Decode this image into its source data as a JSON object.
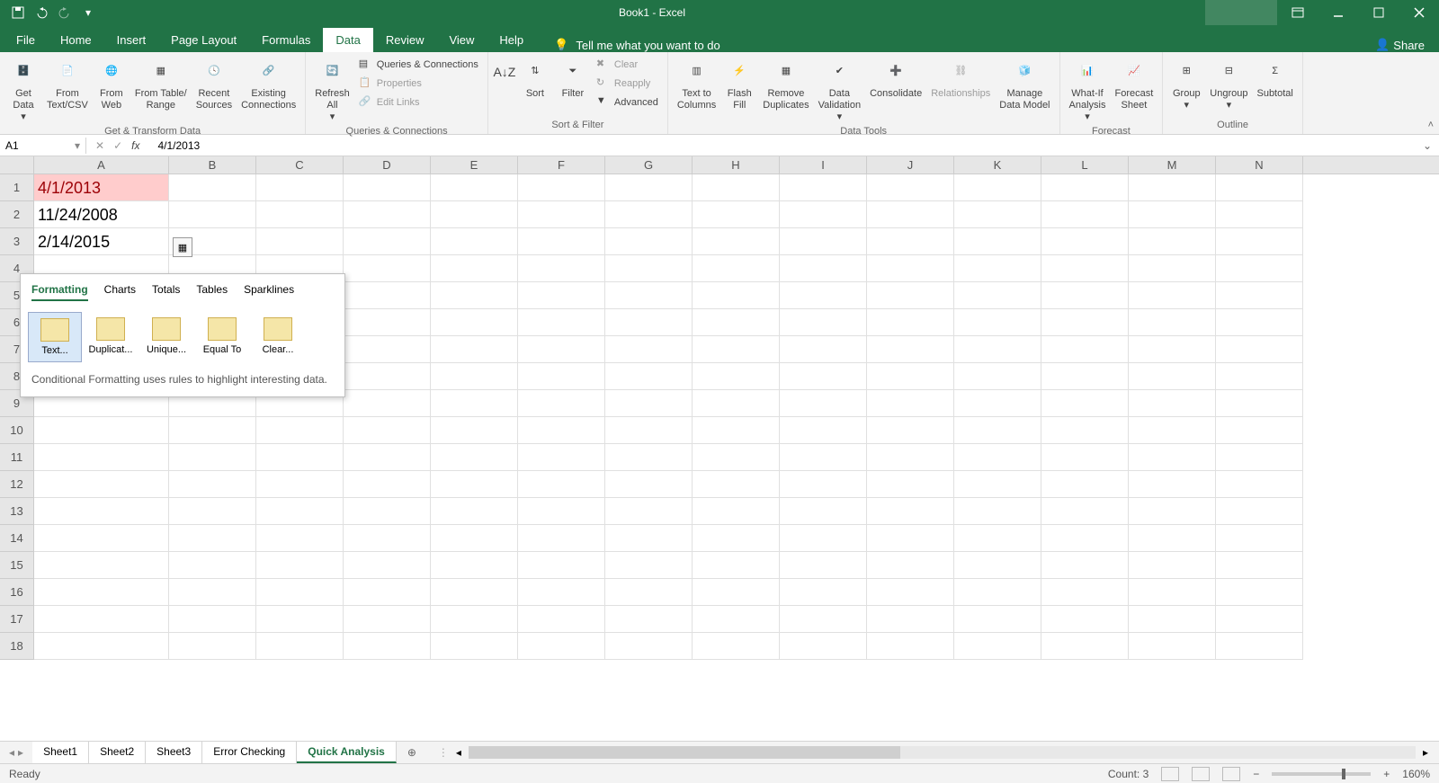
{
  "titlebar": {
    "title": "Book1 - Excel"
  },
  "tabs": {
    "file": "File",
    "list": [
      "Home",
      "Insert",
      "Page Layout",
      "Formulas",
      "Data",
      "Review",
      "View",
      "Help"
    ],
    "active": "Data",
    "tellme": "Tell me what you want to do",
    "share": "Share"
  },
  "ribbon": {
    "groups": {
      "transform": {
        "label": "Get & Transform Data",
        "buttons": [
          "Get\nData",
          "From\nText/CSV",
          "From\nWeb",
          "From Table/\nRange",
          "Recent\nSources",
          "Existing\nConnections"
        ]
      },
      "queries": {
        "label": "Queries & Connections",
        "refresh": "Refresh\nAll",
        "items": [
          "Queries & Connections",
          "Properties",
          "Edit Links"
        ]
      },
      "sortfilter": {
        "label": "Sort & Filter",
        "sort": "Sort",
        "filter": "Filter",
        "items": [
          "Clear",
          "Reapply",
          "Advanced"
        ]
      },
      "datatools": {
        "label": "Data Tools",
        "buttons": [
          "Text to\nColumns",
          "Flash\nFill",
          "Remove\nDuplicates",
          "Data\nValidation",
          "Consolidate",
          "Relationships",
          "Manage\nData Model"
        ]
      },
      "forecast": {
        "label": "Forecast",
        "buttons": [
          "What-If\nAnalysis",
          "Forecast\nSheet"
        ]
      },
      "outline": {
        "label": "Outline",
        "buttons": [
          "Group",
          "Ungroup",
          "Subtotal"
        ]
      }
    }
  },
  "formula_bar": {
    "name": "A1",
    "value": "4/1/2013"
  },
  "grid": {
    "columns": [
      "A",
      "B",
      "C",
      "D",
      "E",
      "F",
      "G",
      "H",
      "I",
      "J",
      "K",
      "L",
      "M",
      "N"
    ],
    "row_count": 18,
    "cells": {
      "A1": {
        "v": "4/1/2013",
        "highlight": true
      },
      "A2": {
        "v": "11/24/2008"
      },
      "A3": {
        "v": "2/14/2015"
      }
    }
  },
  "quick_analysis": {
    "tabs": [
      "Formatting",
      "Charts",
      "Totals",
      "Tables",
      "Sparklines"
    ],
    "active": "Formatting",
    "options": [
      "Text...",
      "Duplicat...",
      "Unique...",
      "Equal To",
      "Clear..."
    ],
    "selected": "Text...",
    "desc": "Conditional Formatting uses rules to highlight interesting data."
  },
  "sheets": {
    "list": [
      "Sheet1",
      "Sheet2",
      "Sheet3",
      "Error Checking",
      "Quick Analysis"
    ],
    "active": "Quick Analysis"
  },
  "status": {
    "ready": "Ready",
    "count": "Count: 3",
    "zoom": "160%"
  }
}
